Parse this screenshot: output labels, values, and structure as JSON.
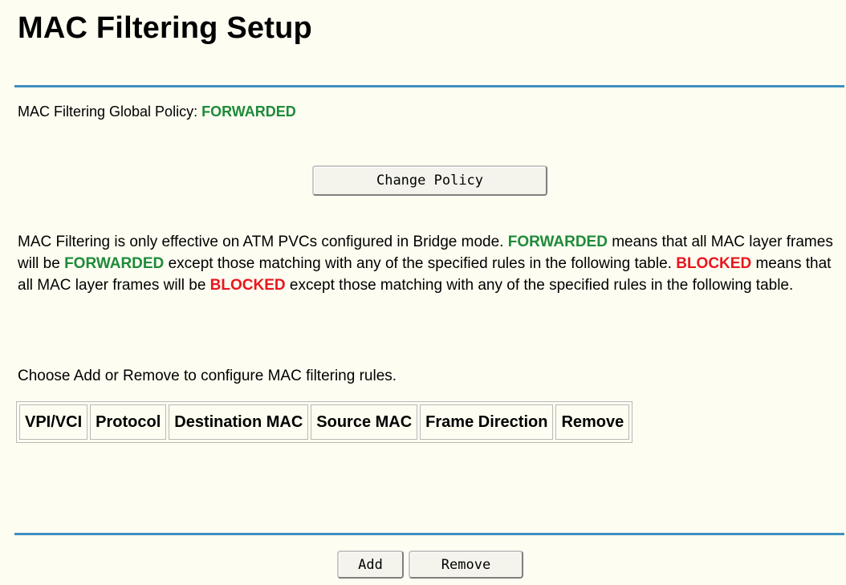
{
  "page": {
    "title": "MAC Filtering Setup"
  },
  "policy": {
    "label": "MAC Filtering Global Policy: ",
    "value": "FORWARDED"
  },
  "buttons": {
    "change_policy": "Change Policy",
    "add": "Add",
    "remove": "Remove"
  },
  "description": {
    "part1": "MAC Filtering is only effective on ATM PVCs configured in Bridge mode. ",
    "forwarded1": "FORWARDED",
    "part2": " means that all MAC layer frames will be ",
    "forwarded2": "FORWARDED",
    "part3": " except those matching with any of the specified rules in the following table. ",
    "blocked1": "BLOCKED",
    "part4": " means that all MAC layer frames will be ",
    "blocked2": "BLOCKED",
    "part5": " except those matching with any of the specified rules in the following table."
  },
  "instruction": "Choose Add or Remove to configure MAC filtering rules.",
  "table": {
    "columns": [
      "VPI/VCI",
      "Protocol",
      "Destination MAC",
      "Source MAC",
      "Frame Direction",
      "Remove"
    ],
    "rows": []
  },
  "colors": {
    "background": "#fdfdf1",
    "rule": "#3f8fc0",
    "forwarded": "#1e8a3a",
    "blocked": "#e8161e"
  }
}
